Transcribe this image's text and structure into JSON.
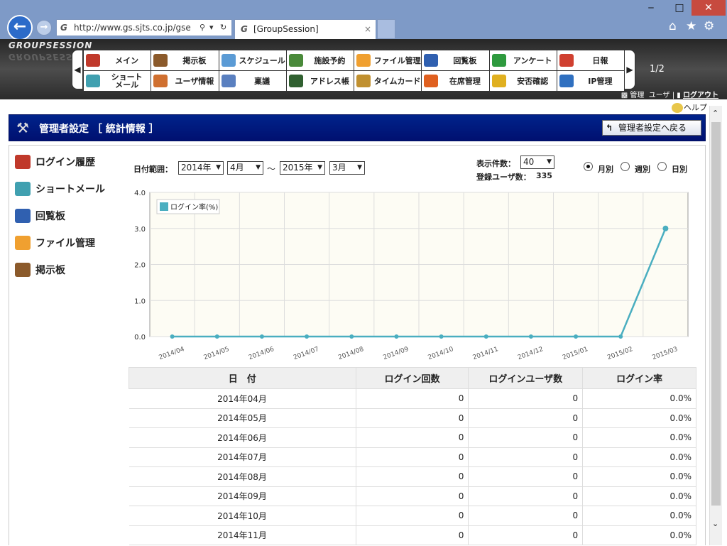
{
  "browser": {
    "url": "http://www.gs.sjts.co.jp/gse",
    "tab_title": "[GroupSession]",
    "tab_close": "×",
    "back_glyph": "←",
    "forward_glyph": "→",
    "window_controls": {
      "minimize": "‒",
      "maximize": "□",
      "close": "✕"
    },
    "toolbar_icons": [
      "home-icon",
      "star-icon",
      "gear-icon"
    ]
  },
  "header": {
    "logo": "GROUPSESSION",
    "menu": [
      {
        "label": "メイン",
        "icon": "home-icon",
        "color": "#c0392b"
      },
      {
        "label": "掲示板",
        "icon": "board-icon",
        "color": "#8b5a2b"
      },
      {
        "label": "スケジュール",
        "icon": "schedule-icon",
        "color": "#5b9bd5"
      },
      {
        "label": "施設予約",
        "icon": "facility-icon",
        "color": "#4a8a3a"
      },
      {
        "label": "ファイル管理",
        "icon": "folder-icon",
        "color": "#f0a030"
      },
      {
        "label": "回覧板",
        "icon": "circular-icon",
        "color": "#3060b0"
      },
      {
        "label": "アンケート",
        "icon": "check-icon",
        "color": "#2e9a3e"
      },
      {
        "label": "日報",
        "icon": "daily-report-icon",
        "color": "#d04030"
      },
      {
        "label": "ショート\nメール",
        "icon": "short-mail-icon",
        "color": "#40a0b0"
      },
      {
        "label": "ユーザ情報",
        "icon": "user-icon",
        "color": "#d07030"
      },
      {
        "label": "稟議",
        "icon": "approval-icon",
        "color": "#5a80c0"
      },
      {
        "label": "アドレス帳",
        "icon": "address-book-icon",
        "color": "#306030"
      },
      {
        "label": "タイムカード",
        "icon": "clock-icon",
        "color": "#c09030"
      },
      {
        "label": "在席管理",
        "icon": "presence-icon",
        "color": "#e06020"
      },
      {
        "label": "安否確認",
        "icon": "safety-icon",
        "color": "#e0b020"
      },
      {
        "label": "IP管理",
        "icon": "ip-icon",
        "color": "#3070c0"
      }
    ],
    "prev_glyph": "◀",
    "next_glyph": "▶",
    "page_indicator": "1/2",
    "links": {
      "admin": "管理",
      "user": "ユーザ",
      "separator": "|",
      "logout": "ログアウト"
    },
    "help": "ヘルプ"
  },
  "titlebar": {
    "title": "管理者設定 ［ 統計情報 ］",
    "back_button": "管理者設定へ戻る",
    "back_arrow": "↰"
  },
  "sidebar": {
    "items": [
      {
        "label": "ログイン履歴",
        "icon": "login-history-icon",
        "color": "#c0392b"
      },
      {
        "label": "ショートメール",
        "icon": "short-mail-icon",
        "color": "#40a0b0"
      },
      {
        "label": "回覧板",
        "icon": "circular-icon",
        "color": "#3060b0"
      },
      {
        "label": "ファイル管理",
        "icon": "folder-icon",
        "color": "#f0a030"
      },
      {
        "label": "掲示板",
        "icon": "board-icon",
        "color": "#8b5a2b"
      }
    ]
  },
  "filters": {
    "date_range_label": "日付範囲：",
    "from_year": "2014年",
    "from_month": "4月",
    "tilde": "～",
    "to_year": "2015年",
    "to_month": "3月",
    "display_count_label": "表示件数：",
    "display_count": "40",
    "registered_users_label": "登録ユーザ数：",
    "registered_users": "335",
    "dropdown_glyph": "▼",
    "view_modes": [
      {
        "label": "月別",
        "selected": true
      },
      {
        "label": "週別",
        "selected": false
      },
      {
        "label": "日別",
        "selected": false
      }
    ]
  },
  "chart_data": {
    "type": "line",
    "categories": [
      "2014/04",
      "2014/05",
      "2014/06",
      "2014/07",
      "2014/08",
      "2014/09",
      "2014/10",
      "2014/11",
      "2014/12",
      "2015/01",
      "2015/02",
      "2015/03"
    ],
    "series": [
      {
        "name": "ログイン率(%)",
        "values": [
          0,
          0,
          0,
          0,
          0,
          0,
          0,
          0,
          0,
          0,
          0,
          3.0
        ],
        "color": "#4aaec0"
      }
    ],
    "y_ticks": [
      "0.0",
      "1.0",
      "2.0",
      "3.0",
      "4.0"
    ],
    "ylim": [
      0,
      4
    ],
    "grid": true,
    "legend_position": "top-left",
    "background": "#fdfcf4"
  },
  "table": {
    "headers": [
      "日　付",
      "ログイン回数",
      "ログインユーザ数",
      "ログイン率"
    ],
    "rows": [
      [
        "2014年04月",
        "0",
        "0",
        "0.0%"
      ],
      [
        "2014年05月",
        "0",
        "0",
        "0.0%"
      ],
      [
        "2014年06月",
        "0",
        "0",
        "0.0%"
      ],
      [
        "2014年07月",
        "0",
        "0",
        "0.0%"
      ],
      [
        "2014年08月",
        "0",
        "0",
        "0.0%"
      ],
      [
        "2014年09月",
        "0",
        "0",
        "0.0%"
      ],
      [
        "2014年10月",
        "0",
        "0",
        "0.0%"
      ],
      [
        "2014年11月",
        "0",
        "0",
        "0.0%"
      ]
    ]
  }
}
